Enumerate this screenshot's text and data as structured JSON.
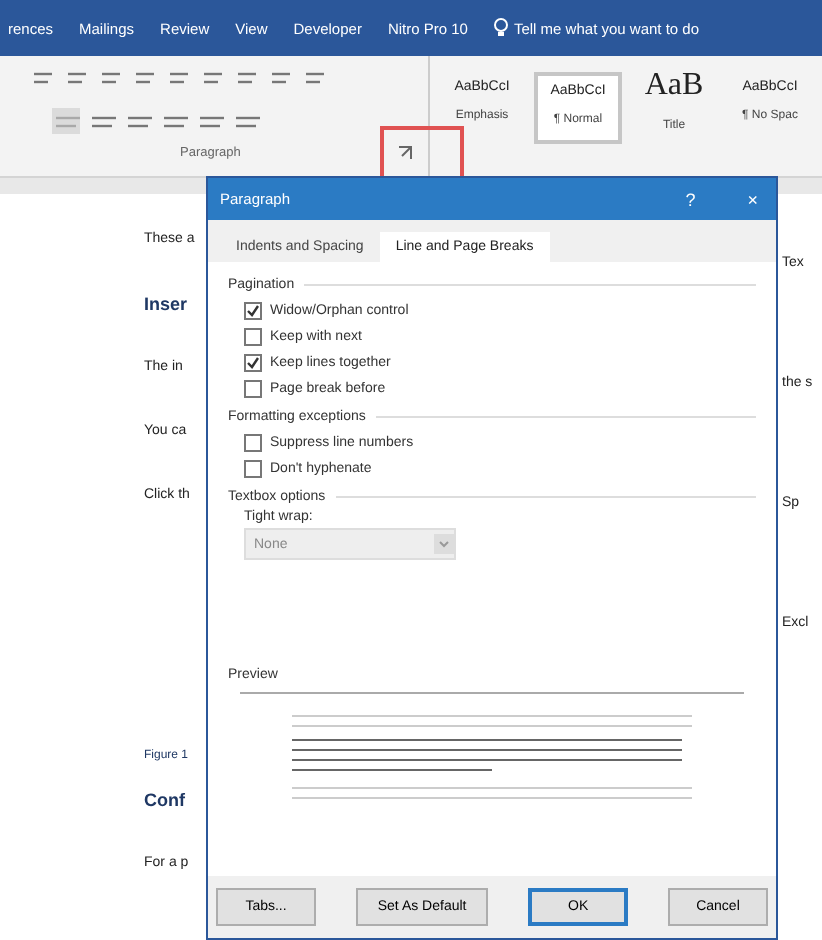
{
  "ribbon_tabs": [
    {
      "label": "rences",
      "selected": false
    },
    {
      "label": "Mailings",
      "selected": false
    },
    {
      "label": "Review",
      "selected": false
    },
    {
      "label": "View",
      "selected": false
    },
    {
      "label": "Developer",
      "selected": false
    },
    {
      "label": "Nitro Pro 10",
      "selected": false
    }
  ],
  "tell_me": "Tell me what you want to do",
  "styles": [
    {
      "sample": "AaBbCcI",
      "name": "Emphasis",
      "selected": false
    },
    {
      "sample": "AaBbCcI",
      "name": "¶ Normal",
      "selected": true
    },
    {
      "sample": "AaB",
      "name": "Title",
      "selected": false
    },
    {
      "sample": "AaBbCcI",
      "name": "¶ No Spac",
      "selected": false
    }
  ],
  "group_label": "Paragraph",
  "document": {
    "left": [
      {
        "text": "These a",
        "kind": "body"
      },
      {
        "text": "Inser",
        "kind": "heading"
      },
      {
        "text": "The in",
        "kind": "body"
      },
      {
        "text": "You ca",
        "kind": "body"
      },
      {
        "text": "Click th",
        "kind": "body"
      },
      {
        "text": "Figure 1",
        "kind": "caption"
      },
      {
        "text": "Conf",
        "kind": "heading"
      },
      {
        "text": "For a p",
        "kind": "body"
      }
    ],
    "right": [
      "Tex",
      "the s",
      "Sp",
      "Excl"
    ]
  },
  "dialog": {
    "title": "Paragraph",
    "help": "?",
    "close": "×",
    "tabs": [
      {
        "label": "Indents and Spacing",
        "selected": false
      },
      {
        "label": "Line and Page Breaks",
        "selected": true
      }
    ],
    "sections": [
      {
        "title": "Pagination",
        "options": [
          {
            "label": "Widow/Orphan control",
            "checked": true
          },
          {
            "label": "Keep with next",
            "checked": false
          },
          {
            "label": "Keep lines together",
            "checked": true
          },
          {
            "label": "Page break before",
            "checked": false
          }
        ]
      },
      {
        "title": "Formatting exceptions",
        "options": [
          {
            "label": "Suppress line numbers",
            "checked": false
          },
          {
            "label": "Don't hyphenate",
            "checked": false
          }
        ]
      }
    ],
    "textbox_title": "Textbox options",
    "tight_wrap_label": "Tight wrap:",
    "tight_wrap_value": "None",
    "preview_title": "Preview",
    "buttons": [
      {
        "label": "Tabs...",
        "kind": "normal"
      },
      {
        "label": "Set As Default",
        "kind": "normal"
      },
      {
        "label": "OK",
        "kind": "default"
      },
      {
        "label": "Cancel",
        "kind": "normal"
      }
    ]
  }
}
